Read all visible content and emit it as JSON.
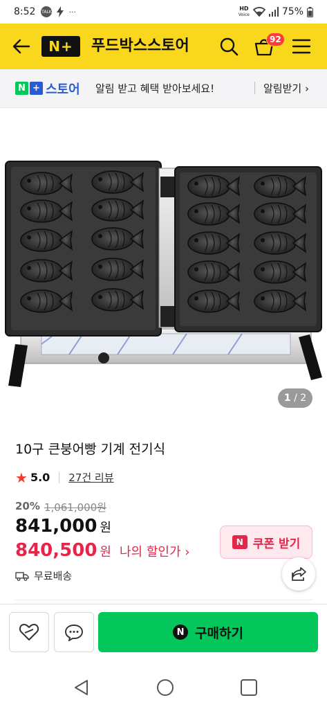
{
  "status": {
    "time": "8:52",
    "battery": "75%",
    "talk": "TALK",
    "hd_top": "HD",
    "hd_bottom": "Voice",
    "more": "···"
  },
  "header": {
    "logo": "N+",
    "store_name": "푸드박스스토어",
    "cart_count": "92"
  },
  "notice": {
    "store_label": "스토어",
    "message": "알림 받고 혜택 받아보세요!",
    "link": "알림받기 ›"
  },
  "gallery": {
    "current": "1",
    "total": "/ 2"
  },
  "product": {
    "title": "10구 큰붕어빵 기계 전기식",
    "rating": "5.0",
    "reviews": "27건 리뷰",
    "discount": "20%",
    "original_price": "1,061,000원",
    "price": "841,000",
    "price_unit": "원",
    "my_price": "840,500",
    "my_price_unit": "원",
    "my_price_label": "나의 할인가 ›",
    "coupon_label": "쿠폰 받기",
    "coupon_badge": "N",
    "shipping": "무료배송"
  },
  "actions": {
    "buy_label": "구매하기",
    "buy_badge": "N"
  },
  "colors": {
    "brand_yellow": "#f9d71c",
    "naver_green": "#03c75a",
    "sale_red": "#e4264a",
    "badge_red": "#ff3b3b"
  }
}
